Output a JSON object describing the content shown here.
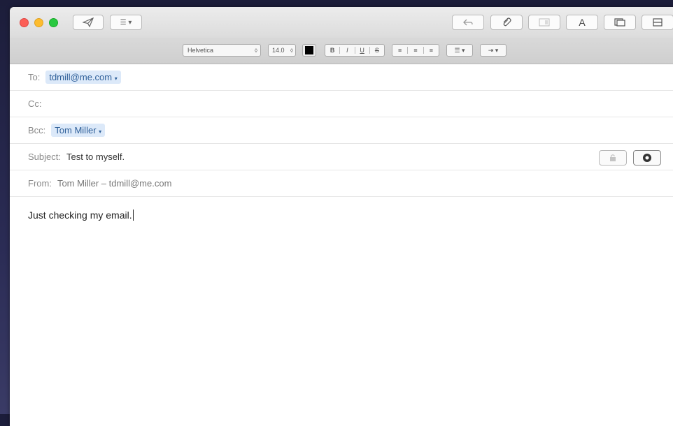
{
  "toolbar": {
    "format_menu_label": "☰ ▾",
    "font_label": "A"
  },
  "format": {
    "font_family": "Helvetica",
    "font_size": "14.0",
    "text_color": "#000000",
    "bold_label": "B",
    "italic_label": "I",
    "underline_label": "U",
    "strike_label": "S"
  },
  "header": {
    "to_label": "To:",
    "to_value": "tdmill@me.com",
    "cc_label": "Cc:",
    "bcc_label": "Bcc:",
    "bcc_value": "Tom Miller",
    "subject_label": "Subject:",
    "subject_value": "Test to myself.",
    "from_label": "From:",
    "from_value": "Tom Miller – tdmill@me.com"
  },
  "body": {
    "text": "Just checking my email."
  },
  "colors": {
    "token_bg": "#dce9f9",
    "close": "#fc5f57",
    "minimize": "#fdbc2e",
    "zoom": "#29c840"
  }
}
